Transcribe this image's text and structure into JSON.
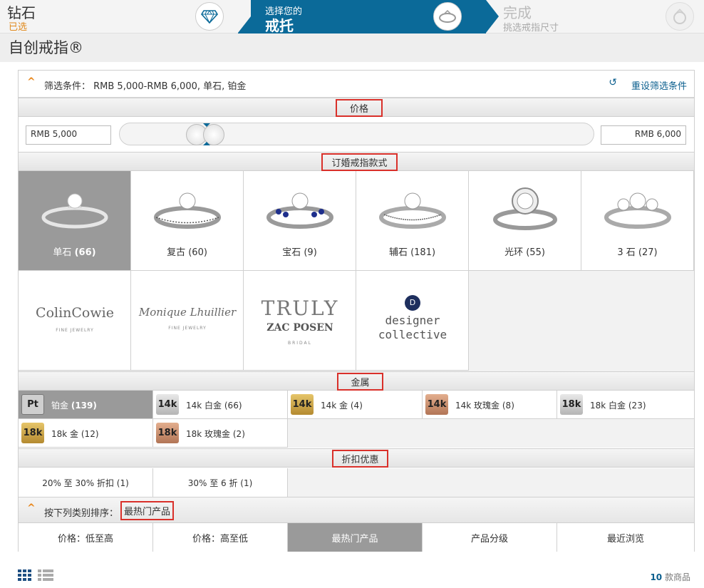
{
  "steps": [
    {
      "title": "钻石",
      "subtitle": "已选",
      "icon": "diamond-icon"
    },
    {
      "title": "选择您的",
      "subtitle": "戒托",
      "icon": "ring-setting-icon"
    },
    {
      "title": "完成",
      "subtitle": "挑选戒指尺寸",
      "icon": "ring-complete-icon"
    }
  ],
  "page_title": "自创戒指®",
  "filter": {
    "label": "筛选条件： RMB 5,000-RMB 6,000, 单石, 铂金",
    "reset": "重设筛选条件"
  },
  "price": {
    "heading": "价格",
    "min": "RMB 5,000",
    "max": "RMB 6,000"
  },
  "styles": {
    "heading": "订婚戒指款式",
    "items": [
      {
        "label": "单石",
        "count": "(66)"
      },
      {
        "label": "复古",
        "count": "(60)"
      },
      {
        "label": "宝石",
        "count": "(9)"
      },
      {
        "label": "辅石",
        "count": "(181)"
      },
      {
        "label": "光环",
        "count": "(55)"
      },
      {
        "label": "3 石",
        "count": "(27)"
      }
    ],
    "brands": [
      {
        "name": "ColinCowie",
        "sub": "FINE JEWELRY"
      },
      {
        "name": "Monique Lhuillier",
        "sub": "FINE JEWELRY"
      },
      {
        "name": "TRULY",
        "name2": "ZAC POSEN",
        "sub": "BRIDAL"
      },
      {
        "name": "designer",
        "name2": "collective"
      }
    ]
  },
  "metal": {
    "heading": "金属",
    "items": [
      {
        "chip": "Pt",
        "label": "铂金",
        "count": "(139)",
        "color": "#8c8c8c"
      },
      {
        "chip": "14k",
        "label": "14k 白金",
        "count": "(66)",
        "color": "#c8c8c8"
      },
      {
        "chip": "14k",
        "label": "14k 金",
        "count": "(4)",
        "color": "#c9a24a"
      },
      {
        "chip": "14k",
        "label": "14k 玫瑰金",
        "count": "(8)",
        "color": "#c99070"
      },
      {
        "chip": "18k",
        "label": "18k 白金",
        "count": "(23)",
        "color": "#c8c8c8"
      },
      {
        "chip": "18k",
        "label": "18k 金",
        "count": "(12)",
        "color": "#c9a24a"
      },
      {
        "chip": "18k",
        "label": "18k 玫瑰金",
        "count": "(2)",
        "color": "#c99070"
      }
    ]
  },
  "discount": {
    "heading": "折扣优惠",
    "items": [
      "20% 至 30% 折扣 (1)",
      "30% 至 6 折 (1)"
    ]
  },
  "sort": {
    "label": "按下列类别排序：",
    "selected": "最热门产品",
    "options": [
      "价格：低至高",
      "价格：高至低",
      "最热门产品",
      "产品分级",
      "最近浏览"
    ]
  },
  "results": {
    "count": "10",
    "unit": "款商品"
  },
  "colors": {
    "accent": "#0b6a99",
    "highlight": "#d9302a",
    "orange": "#e8861a"
  }
}
